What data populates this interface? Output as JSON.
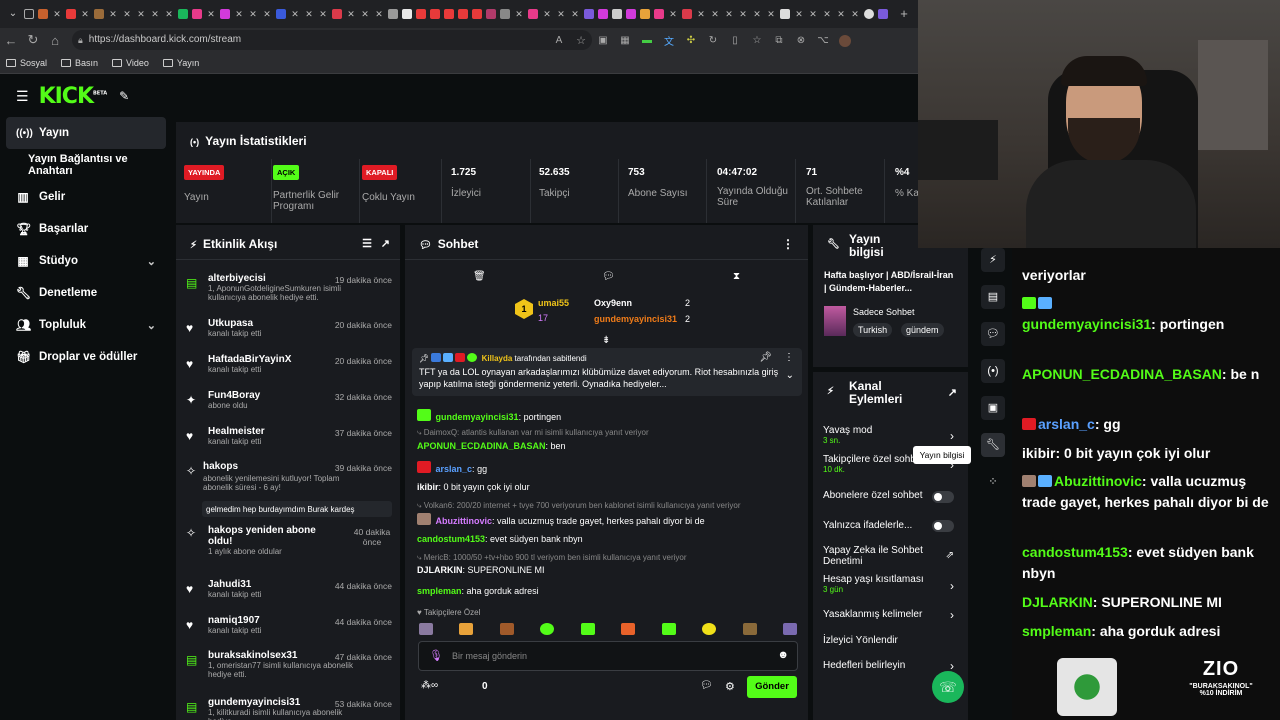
{
  "browser": {
    "url": "https://dashboard.kick.com/stream",
    "bookmarks": [
      "Sosyal",
      "Basın",
      "Video",
      "Yayın"
    ]
  },
  "topnav": {
    "logo": "KICK",
    "logo_sup": "BETA"
  },
  "sidebar": {
    "items": [
      {
        "label": "Yayın",
        "icon": "stream-icon"
      },
      {
        "label": "Yayın Bağlantısı ve Anahtarı",
        "icon": ""
      },
      {
        "label": "Gelir",
        "icon": "chart-icon"
      },
      {
        "label": "Başarılar",
        "icon": "trophy-icon"
      },
      {
        "label": "Stüdyo",
        "icon": "grid-icon"
      },
      {
        "label": "Denetleme",
        "icon": "wrench-icon"
      },
      {
        "label": "Topluluk",
        "icon": "people-icon"
      },
      {
        "label": "Droplar ve ödüller",
        "icon": "gift-icon"
      }
    ]
  },
  "stats_panel": {
    "title": "Yayın İstatistikleri",
    "items": [
      {
        "badge": "YAYINDA",
        "label": "Yayın"
      },
      {
        "badge": "AÇIK",
        "label": "Partnerlik Gelir Programı"
      },
      {
        "badge": "KAPALI",
        "label": "Çoklu Yayın"
      },
      {
        "value": "1.725",
        "label": "İzleyici"
      },
      {
        "value": "52.635",
        "label": "Takipçi"
      },
      {
        "value": "753",
        "label": "Abone Sayısı"
      },
      {
        "value": "04:47:02",
        "label": "Yayında Olduğu Süre"
      },
      {
        "value": "71",
        "label": "Ort. Sohbete Katılanlar"
      },
      {
        "value": "%4",
        "label": "% Ka"
      }
    ]
  },
  "activity": {
    "title": "Etkinlik Akışı",
    "items": [
      {
        "user": "alterbiyecisi",
        "desc": "1, AponunGotdeligineSumkuren isimli kullanıcıya abonelik hediye etti.",
        "time": "19 dakika önce"
      },
      {
        "user": "Utkupasa",
        "desc": "kanalı takip etti",
        "time": "20 dakika önce"
      },
      {
        "user": "HaftadaBirYayinX",
        "desc": "kanalı takip etti",
        "time": "20 dakika önce"
      },
      {
        "user": "Fun4Boray",
        "desc": "abone oldu",
        "time": "32 dakika önce"
      },
      {
        "user": "Healmeister",
        "desc": "kanalı takip etti",
        "time": "37 dakika önce"
      },
      {
        "user": "hakops",
        "desc": "abonelik yenilemesini kutluyor! Toplam abonelik süresi - 6 ay!",
        "time": "39 dakika önce",
        "quote": "gelmedim hep burdayımdım Burak kardeş"
      },
      {
        "user": "hakops yeniden abone oldu!",
        "desc": "1 aylık abone oldular",
        "time": "40 dakika önce"
      },
      {
        "user": "Jahudi31",
        "desc": "kanalı takip etti",
        "time": "44 dakika önce"
      },
      {
        "user": "namiq1907",
        "desc": "kanalı takip etti",
        "time": "44 dakika önce"
      },
      {
        "user": "buraksakinolsex31",
        "desc": "1, omeristan77 isimli kullanıcıya abonelik hediye etti.",
        "time": "47 dakika önce"
      },
      {
        "user": "gundemyayincisi31",
        "desc": "1, kilitkuradi isimli kullanıcıya abonelik hediye",
        "time": "53 dakika önce"
      }
    ]
  },
  "chat": {
    "title": "Sohbet",
    "leaderboard": [
      {
        "name": "umai55",
        "count": "17"
      },
      {
        "name": "Oxy9enn",
        "count": "2"
      },
      {
        "name": "gundemyayincisi31",
        "count": "2"
      }
    ],
    "pinned": {
      "by": "Killayda",
      "by_suffix": "tarafından sabitlendi",
      "text": "TFT ya da LOL oynayan arkadaşlarımızı klübümüze davet ediyorum. Riot hesabınızla giriş yapıp katılma isteği göndermeniz yeterli. Oynadıka hediyeler..."
    },
    "messages": [
      {
        "user": "gundemyayincisi31",
        "text": "portingen"
      },
      {
        "reply": "DaimoxQ: atlantis kullanan var mi isimli kullanıcıya yanıt veriyor"
      },
      {
        "user": "APONUN_ECDADINA_BASAN",
        "text": "ben"
      },
      {
        "user": "arslan_c",
        "text": "gg"
      },
      {
        "user": "ikibir",
        "text": "0 bit yayın çok iyi olur"
      },
      {
        "reply": "Volkan6: 200/20 internet + tvye 700 veriyorum ben kablonet isimli kullanıcıya yanıt veriyor"
      },
      {
        "user": "Abuzittinovic",
        "text": "valla ucuzmuş trade gayet, herkes pahalı diyor bi de"
      },
      {
        "user": "candostum4153",
        "text": "evet südyen bank nbyn"
      },
      {
        "reply": "MericB: 1000/50 +tv+hbo 900 tl veriyom ben isimli kullanıcıya yanıt veriyor"
      },
      {
        "user": "DJLARKIN",
        "text": "SUPERONLINE MI"
      },
      {
        "user": "smpleman",
        "text": "aha gorduk adresi"
      }
    ],
    "followers_only": "Takipçilere Özel",
    "input_placeholder": "Bir mesaj gönderin",
    "points": "0",
    "send": "Gönder"
  },
  "stream_info": {
    "title": "Yayın bilgisi",
    "stream_title": "Hafta başlıyor | ABD/İsrail-İran | Gündem-Haberler...",
    "category": "Sadece Sohbet",
    "tags": [
      "Turkish",
      "gündem"
    ]
  },
  "channel_actions": {
    "title": "Kanal Eylemleri",
    "items": [
      {
        "label": "Yavaş mod",
        "sub": "3 sn.",
        "control": "arrow"
      },
      {
        "label": "Takipçilere özel sohbet",
        "sub": "10 dk.",
        "control": "arrow"
      },
      {
        "label": "Abonelere özel sohbet",
        "sub": "",
        "control": "toggle"
      },
      {
        "label": "Yalnızca ifadelerle...",
        "sub": "",
        "control": "toggle"
      },
      {
        "label": "Yapay Zeka ile Sohbet Denetimi",
        "sub": "",
        "control": "link"
      },
      {
        "label": "Hesap yaşı kısıtlaması",
        "sub": "3 gün",
        "control": "arrow"
      },
      {
        "label": "Yasaklanmış kelimeler",
        "sub": "",
        "control": "arrow"
      },
      {
        "label": "İzleyici Yönlendir",
        "sub": "",
        "control": "none"
      },
      {
        "label": "Hedefleri belirleyin",
        "sub": "",
        "control": "arrow"
      }
    ],
    "tooltip": "Yayın bilgisi"
  },
  "overlay_chat": {
    "lines": [
      {
        "user": "",
        "text": "veriyorlar"
      },
      {
        "user": "gundemyayincisi31",
        "text": "portingen"
      },
      {
        "user": "APONUN_ECDADINA_BASAN",
        "text": "be n"
      },
      {
        "user": "arslan_c",
        "text": "gg"
      },
      {
        "user": "ikibir",
        "text": "0 bit yayın çok iyi olur"
      },
      {
        "user": "Abuzittinovic",
        "text": "valla ucuzmuş trade gayet, herkes pahalı diyor bi de"
      },
      {
        "user": "candostum4153",
        "text": "evet südyen bank nbyn"
      },
      {
        "user": "DJLARKIN",
        "text": "SUPERONLINE MI"
      },
      {
        "user": "smpleman",
        "text": "aha gorduk adresi"
      }
    ],
    "promo_brand": "ZIO",
    "promo_code": "\"BURAKSAKINOL\"",
    "promo_discount": "%10 İNDİRİM"
  }
}
